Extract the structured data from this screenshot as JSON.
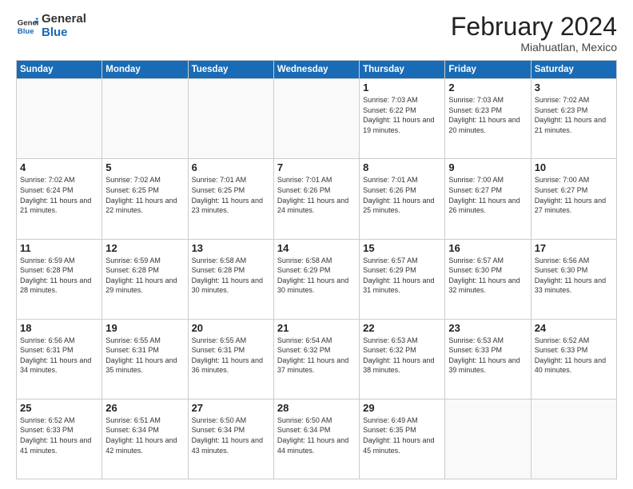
{
  "logo": {
    "line1": "General",
    "line2": "Blue"
  },
  "title": "February 2024",
  "location": "Miahuatlan, Mexico",
  "days_of_week": [
    "Sunday",
    "Monday",
    "Tuesday",
    "Wednesday",
    "Thursday",
    "Friday",
    "Saturday"
  ],
  "weeks": [
    [
      {
        "num": "",
        "sunrise": "",
        "sunset": "",
        "daylight": "",
        "empty": true
      },
      {
        "num": "",
        "sunrise": "",
        "sunset": "",
        "daylight": "",
        "empty": true
      },
      {
        "num": "",
        "sunrise": "",
        "sunset": "",
        "daylight": "",
        "empty": true
      },
      {
        "num": "",
        "sunrise": "",
        "sunset": "",
        "daylight": "",
        "empty": true
      },
      {
        "num": "1",
        "sunrise": "Sunrise: 7:03 AM",
        "sunset": "Sunset: 6:22 PM",
        "daylight": "Daylight: 11 hours and 19 minutes.",
        "empty": false
      },
      {
        "num": "2",
        "sunrise": "Sunrise: 7:03 AM",
        "sunset": "Sunset: 6:23 PM",
        "daylight": "Daylight: 11 hours and 20 minutes.",
        "empty": false
      },
      {
        "num": "3",
        "sunrise": "Sunrise: 7:02 AM",
        "sunset": "Sunset: 6:23 PM",
        "daylight": "Daylight: 11 hours and 21 minutes.",
        "empty": false
      }
    ],
    [
      {
        "num": "4",
        "sunrise": "Sunrise: 7:02 AM",
        "sunset": "Sunset: 6:24 PM",
        "daylight": "Daylight: 11 hours and 21 minutes.",
        "empty": false
      },
      {
        "num": "5",
        "sunrise": "Sunrise: 7:02 AM",
        "sunset": "Sunset: 6:25 PM",
        "daylight": "Daylight: 11 hours and 22 minutes.",
        "empty": false
      },
      {
        "num": "6",
        "sunrise": "Sunrise: 7:01 AM",
        "sunset": "Sunset: 6:25 PM",
        "daylight": "Daylight: 11 hours and 23 minutes.",
        "empty": false
      },
      {
        "num": "7",
        "sunrise": "Sunrise: 7:01 AM",
        "sunset": "Sunset: 6:26 PM",
        "daylight": "Daylight: 11 hours and 24 minutes.",
        "empty": false
      },
      {
        "num": "8",
        "sunrise": "Sunrise: 7:01 AM",
        "sunset": "Sunset: 6:26 PM",
        "daylight": "Daylight: 11 hours and 25 minutes.",
        "empty": false
      },
      {
        "num": "9",
        "sunrise": "Sunrise: 7:00 AM",
        "sunset": "Sunset: 6:27 PM",
        "daylight": "Daylight: 11 hours and 26 minutes.",
        "empty": false
      },
      {
        "num": "10",
        "sunrise": "Sunrise: 7:00 AM",
        "sunset": "Sunset: 6:27 PM",
        "daylight": "Daylight: 11 hours and 27 minutes.",
        "empty": false
      }
    ],
    [
      {
        "num": "11",
        "sunrise": "Sunrise: 6:59 AM",
        "sunset": "Sunset: 6:28 PM",
        "daylight": "Daylight: 11 hours and 28 minutes.",
        "empty": false
      },
      {
        "num": "12",
        "sunrise": "Sunrise: 6:59 AM",
        "sunset": "Sunset: 6:28 PM",
        "daylight": "Daylight: 11 hours and 29 minutes.",
        "empty": false
      },
      {
        "num": "13",
        "sunrise": "Sunrise: 6:58 AM",
        "sunset": "Sunset: 6:28 PM",
        "daylight": "Daylight: 11 hours and 30 minutes.",
        "empty": false
      },
      {
        "num": "14",
        "sunrise": "Sunrise: 6:58 AM",
        "sunset": "Sunset: 6:29 PM",
        "daylight": "Daylight: 11 hours and 30 minutes.",
        "empty": false
      },
      {
        "num": "15",
        "sunrise": "Sunrise: 6:57 AM",
        "sunset": "Sunset: 6:29 PM",
        "daylight": "Daylight: 11 hours and 31 minutes.",
        "empty": false
      },
      {
        "num": "16",
        "sunrise": "Sunrise: 6:57 AM",
        "sunset": "Sunset: 6:30 PM",
        "daylight": "Daylight: 11 hours and 32 minutes.",
        "empty": false
      },
      {
        "num": "17",
        "sunrise": "Sunrise: 6:56 AM",
        "sunset": "Sunset: 6:30 PM",
        "daylight": "Daylight: 11 hours and 33 minutes.",
        "empty": false
      }
    ],
    [
      {
        "num": "18",
        "sunrise": "Sunrise: 6:56 AM",
        "sunset": "Sunset: 6:31 PM",
        "daylight": "Daylight: 11 hours and 34 minutes.",
        "empty": false
      },
      {
        "num": "19",
        "sunrise": "Sunrise: 6:55 AM",
        "sunset": "Sunset: 6:31 PM",
        "daylight": "Daylight: 11 hours and 35 minutes.",
        "empty": false
      },
      {
        "num": "20",
        "sunrise": "Sunrise: 6:55 AM",
        "sunset": "Sunset: 6:31 PM",
        "daylight": "Daylight: 11 hours and 36 minutes.",
        "empty": false
      },
      {
        "num": "21",
        "sunrise": "Sunrise: 6:54 AM",
        "sunset": "Sunset: 6:32 PM",
        "daylight": "Daylight: 11 hours and 37 minutes.",
        "empty": false
      },
      {
        "num": "22",
        "sunrise": "Sunrise: 6:53 AM",
        "sunset": "Sunset: 6:32 PM",
        "daylight": "Daylight: 11 hours and 38 minutes.",
        "empty": false
      },
      {
        "num": "23",
        "sunrise": "Sunrise: 6:53 AM",
        "sunset": "Sunset: 6:33 PM",
        "daylight": "Daylight: 11 hours and 39 minutes.",
        "empty": false
      },
      {
        "num": "24",
        "sunrise": "Sunrise: 6:52 AM",
        "sunset": "Sunset: 6:33 PM",
        "daylight": "Daylight: 11 hours and 40 minutes.",
        "empty": false
      }
    ],
    [
      {
        "num": "25",
        "sunrise": "Sunrise: 6:52 AM",
        "sunset": "Sunset: 6:33 PM",
        "daylight": "Daylight: 11 hours and 41 minutes.",
        "empty": false
      },
      {
        "num": "26",
        "sunrise": "Sunrise: 6:51 AM",
        "sunset": "Sunset: 6:34 PM",
        "daylight": "Daylight: 11 hours and 42 minutes.",
        "empty": false
      },
      {
        "num": "27",
        "sunrise": "Sunrise: 6:50 AM",
        "sunset": "Sunset: 6:34 PM",
        "daylight": "Daylight: 11 hours and 43 minutes.",
        "empty": false
      },
      {
        "num": "28",
        "sunrise": "Sunrise: 6:50 AM",
        "sunset": "Sunset: 6:34 PM",
        "daylight": "Daylight: 11 hours and 44 minutes.",
        "empty": false
      },
      {
        "num": "29",
        "sunrise": "Sunrise: 6:49 AM",
        "sunset": "Sunset: 6:35 PM",
        "daylight": "Daylight: 11 hours and 45 minutes.",
        "empty": false
      },
      {
        "num": "",
        "sunrise": "",
        "sunset": "",
        "daylight": "",
        "empty": true
      },
      {
        "num": "",
        "sunrise": "",
        "sunset": "",
        "daylight": "",
        "empty": true
      }
    ]
  ]
}
